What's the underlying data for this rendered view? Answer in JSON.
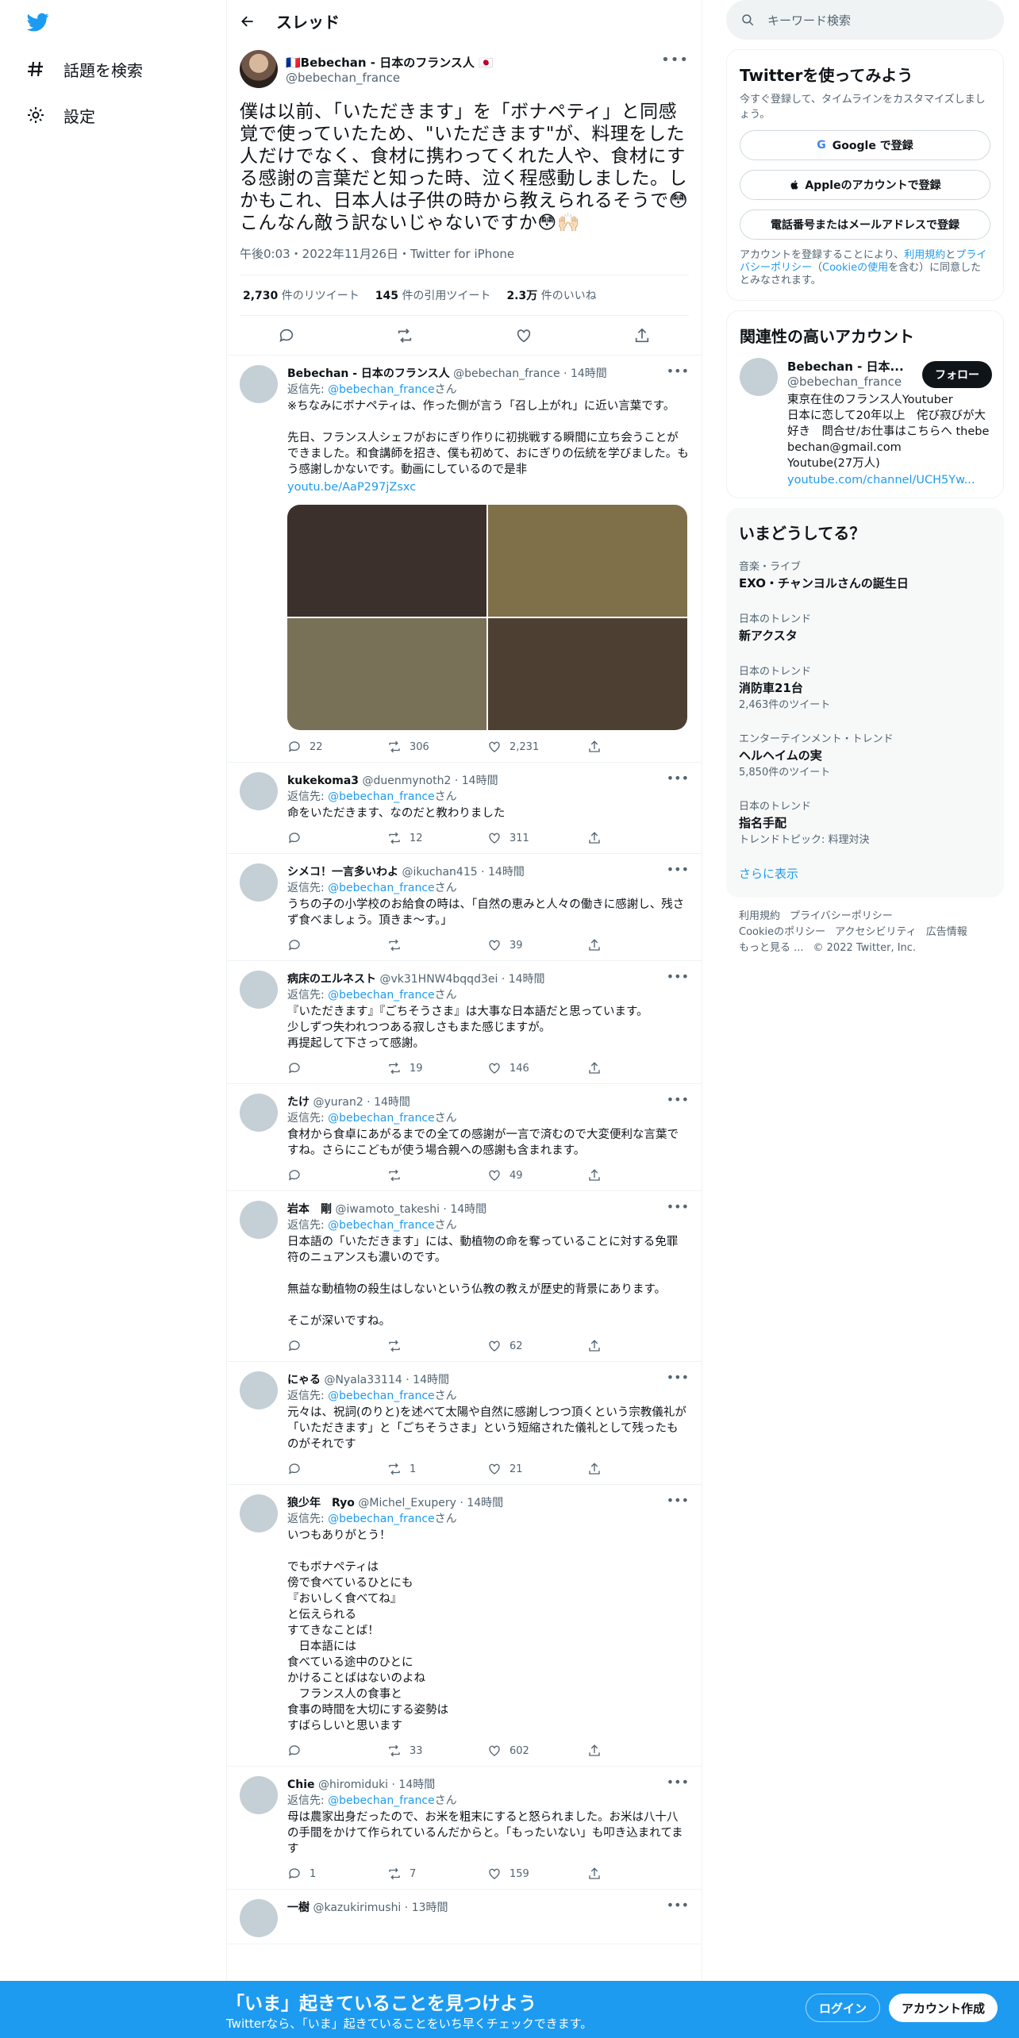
{
  "nav": {
    "items": [
      {
        "label": "話題を検索",
        "icon": "hashtag-icon"
      },
      {
        "label": "設定",
        "icon": "gear-icon"
      }
    ]
  },
  "header": {
    "title": "スレッド"
  },
  "focal": {
    "name": "🇫🇷Bebechan - 日本のフランス人 🇯🇵",
    "handle": "@bebechan_france",
    "text": "僕は以前、「いただきます」を「ボナペティ」と同感覚で使っていたため、\"いただきます\"が、料理をした人だけでなく、食材に携わってくれた人や、食材にする感謝の言葉だと知った時、泣く程感動しました。しかもこれ、日本人は子供の時から教えられるそうで😳こんなん敵う訳ないじゃないですか😳🙌🏻",
    "meta": "午後0:03・2022年11月26日・Twitter for iPhone",
    "stats": [
      {
        "num": "2,730",
        "label": "件のリツイート"
      },
      {
        "num": "145",
        "label": "件の引用ツイート"
      },
      {
        "num": "2.3万",
        "label": "件のいいね"
      }
    ]
  },
  "replies": [
    {
      "name": "Bebechan - 日本のフランス人",
      "handle": "@bebechan_france",
      "time": "14時間",
      "to_prefix": "返信先: ",
      "to": "@bebechan_france",
      "to_suffix": "さん",
      "text": "※ちなみにボナペティは、作った側が言う「召し上がれ」に近い言葉です。\n\n先日、フランス人シェフがおにぎり作りに初挑戦する瞬間に立ち会うことができました。和食講師を招き、僕も初めて、おにぎりの伝統を学びました。もう感謝しかないです。動画にしているので是非",
      "link": "youtu.be/AaP297jZsxc",
      "reply": "22",
      "rt": "306",
      "like": "2,231"
    },
    {
      "name": "kukekoma3",
      "handle": "@duenmynoth2",
      "time": "14時間",
      "to_prefix": "返信先: ",
      "to": "@bebechan_france",
      "to_suffix": "さん",
      "text": "命をいただきます、なのだと教わりました",
      "reply": "",
      "rt": "12",
      "like": "311"
    },
    {
      "name": "シメコ！一言多いわよ",
      "handle": "@ikuchan415",
      "time": "14時間",
      "to_prefix": "返信先: ",
      "to": "@bebechan_france",
      "to_suffix": "さん",
      "text": "うちの子の小学校のお給食の時は、「自然の恵みと人々の働きに感謝し、残さず食べましょう。頂きま〜す。」",
      "reply": "",
      "rt": "",
      "like": "39"
    },
    {
      "name": "病床のエルネスト",
      "handle": "@vk31HNW4bqqd3ei",
      "time": "14時間",
      "to_prefix": "返信先: ",
      "to": "@bebechan_france",
      "to_suffix": "さん",
      "text": "『いただきます』『ごちそうさま』は大事な日本語だと思っています。\n少しずつ失われつつある寂しさもまた感じますが。\n再提起して下さって感謝。",
      "reply": "",
      "rt": "19",
      "like": "146"
    },
    {
      "name": "たけ",
      "handle": "@yuran2",
      "time": "14時間",
      "to_prefix": "返信先: ",
      "to": "@bebechan_france",
      "to_suffix": "さん",
      "text": "食材から食卓にあがるまでの全ての感謝が一言で済むので大変便利な言葉ですね。さらにこどもが使う場合親への感謝も含まれます。",
      "reply": "",
      "rt": "",
      "like": "49"
    },
    {
      "name": "岩本　剛",
      "handle": "@iwamoto_takeshi",
      "time": "14時間",
      "to_prefix": "返信先: ",
      "to": "@bebechan_france",
      "to_suffix": "さん",
      "text": "日本語の「いただきます」には、動植物の命を奪っていることに対する免罪符のニュアンスも濃いのです。\n\n無益な動植物の殺生はしないという仏教の教えが歴史的背景にあります。\n\nそこが深いですね。",
      "reply": "",
      "rt": "",
      "like": "62"
    },
    {
      "name": "にゃる",
      "handle": "@Nyala33114",
      "time": "14時間",
      "to_prefix": "返信先: ",
      "to": "@bebechan_france",
      "to_suffix": "さん",
      "text": "元々は、祝詞(のりと)を述べて太陽や自然に感謝しつつ頂くという宗教儀礼が「いただきます」と「ごちそうさま」という短縮された儀礼として残ったものがそれです",
      "reply": "",
      "rt": "1",
      "like": "21"
    },
    {
      "name": "狼少年　Ryo",
      "handle": "@Michel_Exupery",
      "time": "14時間",
      "to_prefix": "返信先: ",
      "to": "@bebechan_france",
      "to_suffix": "さん",
      "text": "いつもありがとう！\n\nでもボナペティは\n傍で食べているひとにも\n『おいしく食べてね』\nと伝えられる\nすてきなことば！\n　日本語には\n食べている途中のひとに\nかけることばはないのよね\n　フランス人の食事と\n食事の時間を大切にする姿勢は\nすばらしいと思います",
      "reply": "",
      "rt": "33",
      "like": "602"
    },
    {
      "name": "Chie",
      "handle": "@hiromiduki",
      "time": "14時間",
      "to_prefix": "返信先: ",
      "to": "@bebechan_france",
      "to_suffix": "さん",
      "text": "母は農家出身だったので、お米を粗末にすると怒られました。お米は八十八の手間をかけて作られているんだからと。「もったいない」も叩き込まれてます",
      "reply": "1",
      "rt": "7",
      "like": "159"
    },
    {
      "name": "一樹",
      "handle": "@kazukirimushi",
      "time": "13時間",
      "to_prefix": "",
      "to": "",
      "to_suffix": "",
      "text": "",
      "reply": "",
      "rt": "",
      "like": ""
    }
  ],
  "right": {
    "search_placeholder": "キーワード検索",
    "signup": {
      "title": "Twitterを使ってみよう",
      "sub": "今すぐ登録して、タイムラインをカスタマイズしましょう。",
      "google": "Google で登録",
      "apple": "Appleのアカウントで登録",
      "phone": "電話番号またはメールアドレスで登録",
      "terms_1": "アカウントを登録することにより、",
      "terms_link1": "利用規約",
      "terms_2": "と",
      "terms_link2": "プライバシーポリシー",
      "terms_3": "（",
      "terms_link3": "Cookieの使用",
      "terms_4": "を含む）に同意したとみなされます。"
    },
    "related": {
      "title": "関連性の高いアカウント",
      "name": "Bebechan - 日本...",
      "handle": "@bebechan_france",
      "follow": "フォロー",
      "bio": "東京在住のフランス人Youtuber\n日本に恋して20年以上　侘び寂びが大好き　問合せ/お仕事はこちらへ thebebechan@gmail.com\nYoutube(27万人)",
      "link": "youtube.com/channel/UCH5Yw..."
    },
    "trends": {
      "title": "いまどうしてる？",
      "items": [
        {
          "cat": "音楽・ライブ",
          "name": "EXO・チャンヨルさんの誕生日",
          "sub": ""
        },
        {
          "cat": "日本のトレンド",
          "name": "新アクスタ",
          "sub": ""
        },
        {
          "cat": "日本のトレンド",
          "name": "消防車21台",
          "sub": "2,463件のツイート"
        },
        {
          "cat": "エンターテインメント・トレンド",
          "name": "ヘルヘイムの実",
          "sub": "5,850件のツイート"
        },
        {
          "cat": "日本のトレンド",
          "name": "指名手配",
          "sub": "トレンドトピック: 料理対決"
        }
      ],
      "more": "さらに表示"
    },
    "footer": {
      "l1": "利用規約",
      "l2": "プライバシーポリシー",
      "l3": "Cookieのポリシー",
      "l4": "アクセシビリティ",
      "l5": "広告情報",
      "l6": "もっと見る ...",
      "copy": "© 2022 Twitter, Inc."
    }
  },
  "bottom": {
    "title": "「いま」起きていることを見つけよう",
    "sub": "Twitterなら、「いま」起きていることをいち早くチェックできます。",
    "login": "ログイン",
    "signup": "アカウント作成"
  },
  "colors": {
    "accent": "#1d9bf0",
    "text": "#0f1419",
    "muted": "#536471"
  },
  "media_colors": [
    "#3c302d",
    "#7f704a",
    "#787158",
    "#4d4032"
  ]
}
